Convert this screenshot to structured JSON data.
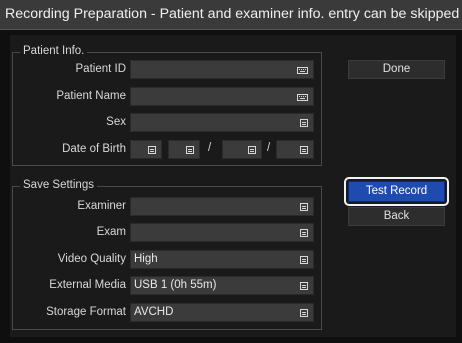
{
  "window": {
    "title": "Recording Preparation - Patient and examiner info. entry can be skipped"
  },
  "patient_info": {
    "title": "Patient Info.",
    "patient_id": {
      "label": "Patient ID",
      "value": ""
    },
    "patient_name": {
      "label": "Patient Name",
      "value": ""
    },
    "sex": {
      "label": "Sex",
      "value": ""
    },
    "date_of_birth": {
      "label": "Date of Birth",
      "separator": "/"
    }
  },
  "save_settings": {
    "title": "Save Settings",
    "examiner": {
      "label": "Examiner",
      "value": ""
    },
    "exam": {
      "label": "Exam",
      "value": ""
    },
    "video_quality": {
      "label": "Video Quality",
      "value": "High"
    },
    "external_media": {
      "label": "External Media",
      "value": "USB 1 (0h 55m)"
    },
    "storage_format": {
      "label": "Storage Format",
      "value": "AVCHD"
    }
  },
  "buttons": {
    "done": "Done",
    "test_record": "Test Record",
    "back": "Back"
  },
  "icons": {
    "keyboard": "keyboard-icon",
    "list": "list-icon"
  },
  "colors": {
    "accent": "#1f4bb0",
    "field_bg": "#3b3b3b",
    "panel_bg": "#1a1a1a"
  }
}
